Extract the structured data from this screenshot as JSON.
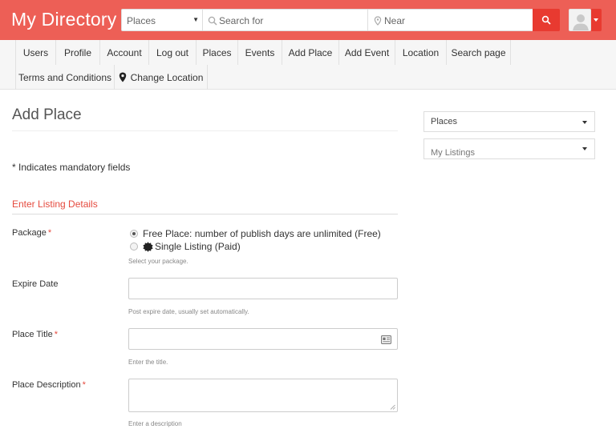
{
  "header": {
    "site_title": "My Directory",
    "post_type": "Places",
    "search_placeholder": "Search for",
    "near_placeholder": "Near",
    "accent_color": "#ed5f56",
    "button_color": "#e83a30"
  },
  "nav": {
    "items": [
      {
        "label": "Users"
      },
      {
        "label": "Profile"
      },
      {
        "label": "Account"
      },
      {
        "label": "Log out"
      },
      {
        "label": "Places"
      },
      {
        "label": "Events"
      },
      {
        "label": "Add Place"
      },
      {
        "label": "Add Event"
      },
      {
        "label": "Location"
      },
      {
        "label": "Search page"
      },
      {
        "label": "Terms and Conditions"
      },
      {
        "label": "Change Location",
        "icon": "map-marker-icon"
      }
    ]
  },
  "main": {
    "page_title": "Add Place",
    "mandatory_note": "*  Indicates mandatory fields",
    "section_title": "Enter Listing Details",
    "package": {
      "label": "Package",
      "required_mark": "*",
      "options": [
        {
          "label": "Free Place: number of publish days are unlimited (Free)",
          "checked": true
        },
        {
          "label": "Single Listing (Paid)",
          "checked": false,
          "icon": "badge-icon"
        }
      ],
      "help": "Select your package."
    },
    "expire_date": {
      "label": "Expire Date",
      "value": "",
      "help": "Post expire date, usually set automatically."
    },
    "place_title": {
      "label": "Place Title",
      "required_mark": "*",
      "value": "",
      "help": "Enter the title."
    },
    "place_description": {
      "label": "Place Description",
      "required_mark": "*",
      "value": "",
      "help": "Enter a description"
    }
  },
  "sidebar": {
    "selects": [
      {
        "label": "Places"
      },
      {
        "label": "My Listings"
      }
    ]
  }
}
